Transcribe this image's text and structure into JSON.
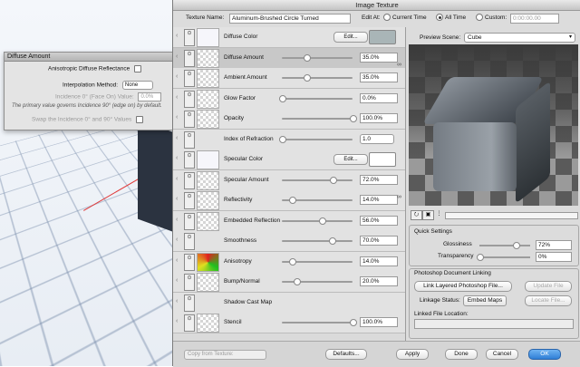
{
  "window": {
    "title": "Image Texture"
  },
  "toolbar": {
    "texture_name_label": "Texture Name:",
    "texture_name_value": "Aluminum-Brushed Circle Turned",
    "edit_at_label": "Edit At:",
    "radio_current": "Current Time",
    "radio_all": "All Time",
    "radio_custom": "Custom:",
    "custom_time": "0:00:00.00"
  },
  "diffuse_panel": {
    "title": "Diffuse Amount",
    "aniso_label": "Anisotropic Diffuse Reflectance",
    "interp_label": "Interpolation Method:",
    "interp_value": "None",
    "incidence0_label": "Incidence 0° (Face On) Value:",
    "incidence0_value": "0.0%",
    "note": "The primary value governs Incidence 90° (edge on) by default.",
    "swap_label": "Swap the Incidence 0° and 90° Values"
  },
  "channels": [
    {
      "label": "Diffuse Color",
      "button": "Edit...",
      "swatch": "#a9b5b7"
    },
    {
      "label": "Diffuse Amount",
      "value": "35.0%",
      "level": 0.35
    },
    {
      "label": "Ambient Amount",
      "value": "35.0%",
      "level": 0.35
    },
    {
      "label": "Glow Factor",
      "value": "0.0%",
      "level": 0.0
    },
    {
      "label": "Opacity",
      "value": "100.0%",
      "level": 1.0
    },
    {
      "label": "Index of Refraction",
      "value": "1.0",
      "level": 0.0
    },
    {
      "label": "Specular Color",
      "button": "Edit...",
      "swatch": "#ffffff"
    },
    {
      "label": "Specular Amount",
      "value": "72.0%",
      "level": 0.72
    },
    {
      "label": "Reflectivity",
      "value": "14.0%",
      "level": 0.14
    },
    {
      "label": "Embedded Reflection",
      "value": "56.0%",
      "level": 0.56
    },
    {
      "label": "Smoothness",
      "value": "70.0%",
      "level": 0.7
    },
    {
      "label": "Anisotropy",
      "value": "14.0%",
      "level": 0.14
    },
    {
      "label": "Bump/Normal",
      "value": "20.0%",
      "level": 0.2
    },
    {
      "label": "Shadow Cast Map"
    },
    {
      "label": "Stencil",
      "value": "100.0%",
      "level": 1.0
    }
  ],
  "preview": {
    "scene_label": "Preview Scene:",
    "scene_value": "Cube"
  },
  "quick": {
    "title": "Quick Settings",
    "glossiness_label": "Glossiness",
    "glossiness_value": "72%",
    "glossiness_level": 0.72,
    "transparency_label": "Transparency",
    "transparency_value": "0%",
    "transparency_level": 0.0
  },
  "psd": {
    "title": "Photoshop Document Linking",
    "link_button": "Link Layered Photoshop File...",
    "update_button": "Update File",
    "linkage_label": "Linkage Status:",
    "linkage_value": "Embed Maps",
    "locate_button": "Locate File...",
    "location_label": "Linked File Location:"
  },
  "bottom": {
    "copy_from": "Copy from Texture:",
    "defaults": "Defaults...",
    "apply": "Apply",
    "done": "Done",
    "cancel": "Cancel",
    "ok": "OK"
  }
}
